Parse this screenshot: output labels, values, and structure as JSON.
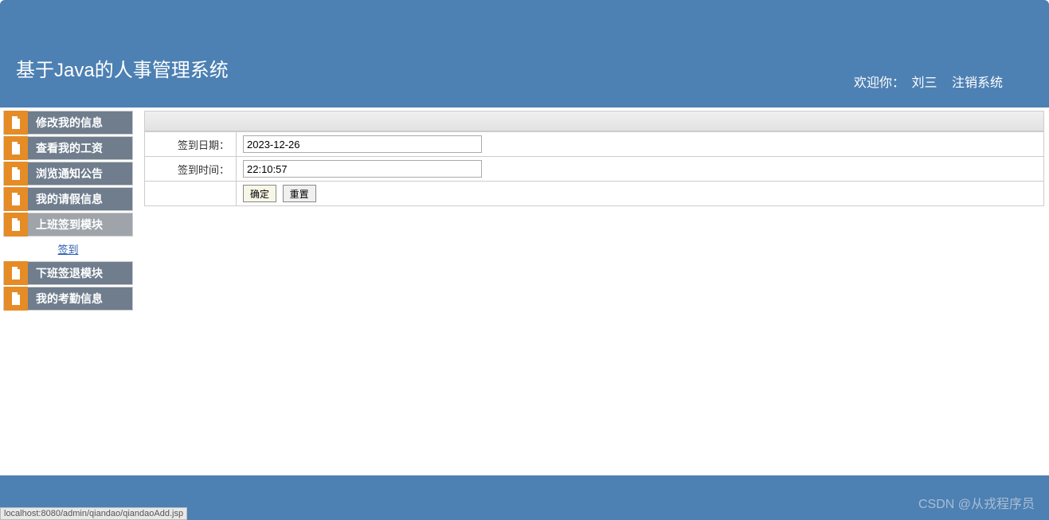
{
  "header": {
    "title": "基于Java的人事管理系统",
    "welcome_label": "欢迎你：",
    "username": "刘三",
    "logout_label": "注销系统"
  },
  "sidebar": {
    "items": [
      {
        "label": "修改我的信息"
      },
      {
        "label": "查看我的工资"
      },
      {
        "label": "浏览通知公告"
      },
      {
        "label": "我的请假信息"
      },
      {
        "label": "上班签到模块",
        "sublink": "签到",
        "active": true
      },
      {
        "label": "下班签退模块"
      },
      {
        "label": "我的考勤信息"
      }
    ]
  },
  "form": {
    "date_label": "签到日期：",
    "date_value": "2023-12-26",
    "time_label": "签到时间：",
    "time_value": "22:10:57",
    "confirm_label": "确定",
    "reset_label": "重置"
  },
  "statusbar": {
    "url": "localhost:8080/admin/qiandao/qiandaoAdd.jsp"
  },
  "watermark": "CSDN @从戎程序员"
}
